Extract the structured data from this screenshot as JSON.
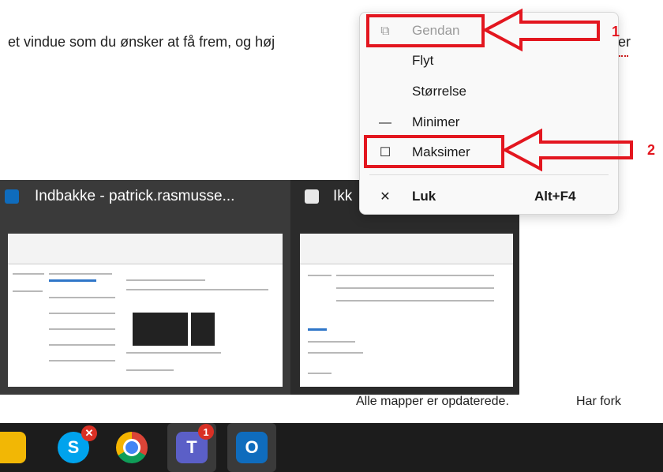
{
  "document": {
    "line_text": "et vindue som du ønsker at få frem, og høj",
    "line_tail": "er"
  },
  "context_menu": {
    "items": [
      {
        "icon": "restore-icon",
        "label": "Gendan",
        "disabled": true
      },
      {
        "icon": "",
        "label": "Flyt"
      },
      {
        "icon": "",
        "label": "Størrelse"
      },
      {
        "icon": "minimize-icon",
        "label": "Minimer"
      },
      {
        "icon": "maximize-icon",
        "label": "Maksimer"
      },
      {
        "icon": "close-icon",
        "label": "Luk",
        "shortcut": "Alt+F4"
      }
    ]
  },
  "annotations": {
    "label_1": "1",
    "label_2": "2",
    "color": "#e3161f"
  },
  "thumbnails": [
    {
      "title": "Indbakke - patrick.rasmusse...",
      "icon": "outlook-icon"
    },
    {
      "title": "Ikk",
      "icon": "message-icon"
    }
  ],
  "status": {
    "text1": "Alle mapper er opdaterede.",
    "text2": "Har fork"
  },
  "taskbar": {
    "apps": [
      {
        "name": "file-explorer"
      },
      {
        "name": "skype"
      },
      {
        "name": "chrome"
      },
      {
        "name": "teams",
        "badge": "1"
      },
      {
        "name": "outlook"
      }
    ]
  }
}
